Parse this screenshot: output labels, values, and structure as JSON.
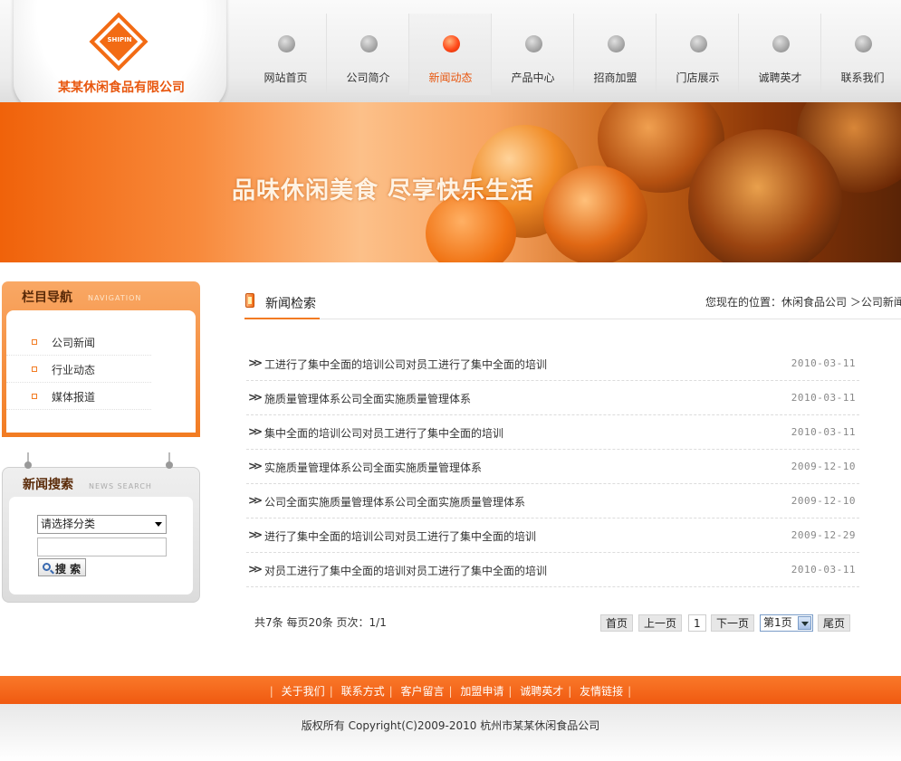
{
  "header": {
    "logo_text": "SHIPIN",
    "company_name": "某某休闲食品有限公司",
    "nav": [
      {
        "label": "网站首页",
        "active": false
      },
      {
        "label": "公司简介",
        "active": false
      },
      {
        "label": "新闻动态",
        "active": true
      },
      {
        "label": "产品中心",
        "active": false
      },
      {
        "label": "招商加盟",
        "active": false
      },
      {
        "label": "门店展示",
        "active": false
      },
      {
        "label": "诚聘英才",
        "active": false
      },
      {
        "label": "联系我们",
        "active": false
      }
    ]
  },
  "banner": {
    "slogan": "品味休闲美食 尽享快乐生活"
  },
  "sidebar": {
    "nav_title": "栏目导航",
    "nav_title_en": "NAVIGATION",
    "categories": [
      "公司新闻",
      "行业动态",
      "媒体报道"
    ],
    "search_title": "新闻搜索",
    "search_title_en": "NEWS SEARCH",
    "select_value": "请选择分类",
    "search_button": "搜 索"
  },
  "main": {
    "title": "新闻检索",
    "breadcrumb": "您现在的位置：休闲食品公司 ＞公司新闻",
    "news": [
      {
        "title": "工进行了集中全面的培训公司对员工进行了集中全面的培训",
        "date": "2010-03-11"
      },
      {
        "title": "施质量管理体系公司全面实施质量管理体系",
        "date": "2010-03-11"
      },
      {
        "title": "集中全面的培训公司对员工进行了集中全面的培训",
        "date": "2010-03-11"
      },
      {
        "title": "实施质量管理体系公司全面实施质量管理体系",
        "date": "2009-12-10"
      },
      {
        "title": "公司全面实施质量管理体系公司全面实施质量管理体系",
        "date": "2009-12-10"
      },
      {
        "title": "进行了集中全面的培训公司对员工进行了集中全面的培训",
        "date": "2009-12-29"
      },
      {
        "title": "对员工进行了集中全面的培训对员工进行了集中全面的培训",
        "date": "2010-03-11"
      }
    ],
    "pagination": {
      "info": "共7条  每页20条  页次：1/1",
      "first": "首页",
      "prev": "上一页",
      "current": "1",
      "next": "下一页",
      "select": "第1页",
      "last": "尾页"
    }
  },
  "footer": {
    "links": [
      "关于我们",
      "联系方式",
      "客户留言",
      "加盟申请",
      "诚聘英才",
      "友情链接"
    ],
    "copyright": "版权所有  Copyright(C)2009-2010 杭州市某某休闲食品公司"
  },
  "colors": {
    "accent": "#f27b22",
    "footer": "#f05a10",
    "active_nav": "#e8570f"
  }
}
